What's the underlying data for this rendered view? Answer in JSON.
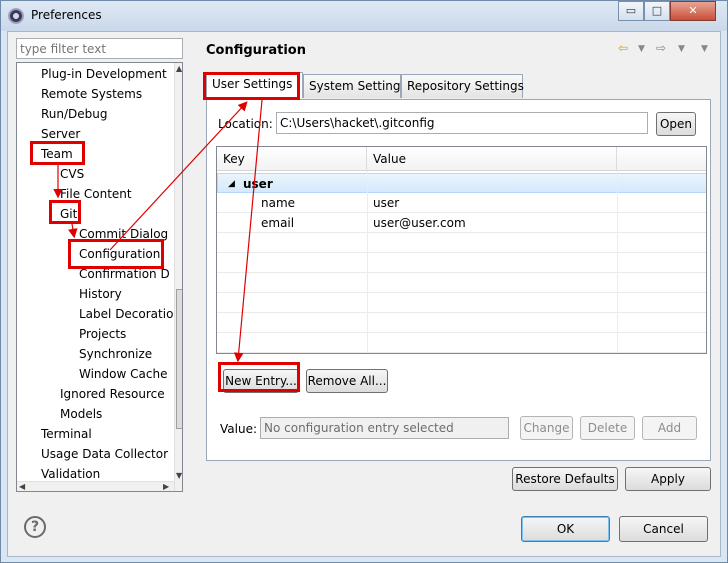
{
  "window": {
    "title": "Preferences",
    "minimize": "▭",
    "maximize": "□",
    "close": "✕"
  },
  "filter": {
    "placeholder": "type filter text"
  },
  "tree": {
    "items": [
      "Plug-in Development",
      "Remote Systems",
      "Run/Debug",
      "Server",
      "Team",
      "CVS",
      "File Content",
      "Git",
      "Commit Dialog",
      "Configuration",
      "Confirmation D",
      "History",
      "Label Decoratio",
      "Projects",
      "Synchronize",
      "Window Cache",
      "Ignored Resource",
      "Models",
      "Terminal",
      "Usage Data Collector",
      "Validation"
    ],
    "collapse_glyph": "◢",
    "expand_glyph": "▷"
  },
  "page": {
    "title": "Configuration"
  },
  "tabs": [
    "User Settings",
    "System Settings",
    "Repository Settings"
  ],
  "location": {
    "label": "Location:",
    "value": "C:\\Users\\hacket\\.gitconfig",
    "open_button": "Open"
  },
  "table": {
    "columns": [
      "Key",
      "Value"
    ],
    "group": "user",
    "rows": [
      {
        "key": "name",
        "value": "user"
      },
      {
        "key": "email",
        "value": "user@user.com"
      }
    ]
  },
  "actions": {
    "new_entry": "New Entry...",
    "remove_all": "Remove All..."
  },
  "value_field": {
    "label": "Value:",
    "placeholder": "No configuration entry selected",
    "change": "Change",
    "delete": "Delete",
    "add": "Add"
  },
  "footer": {
    "restore_defaults": "Restore Defaults",
    "apply": "Apply",
    "ok": "OK",
    "cancel": "Cancel",
    "help": "?"
  },
  "colors": {
    "annotation": "#e00000",
    "selection": "#d5e9fb"
  }
}
